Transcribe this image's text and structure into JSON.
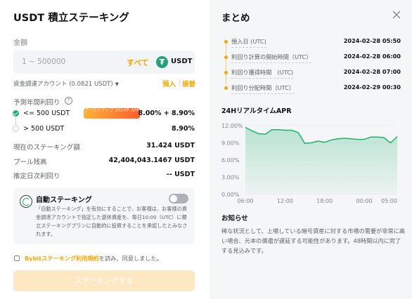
{
  "left": {
    "title": "USDT 積立ステーキング",
    "amount_label": "金額",
    "amount_placeholder": "1 ~ 500000",
    "all_button": "すべて",
    "coin_symbol": "₮",
    "coin": "USDT",
    "funding_account": "資金調達アカウント (0.0821 USDT)",
    "deposit": "預入",
    "transfer": "振替",
    "apr_label": "予測年間利回り",
    "tiers": [
      {
        "label": "<= 500 USDT",
        "value": "8.00% + 8.90%",
        "promo": "ブーストアップ 2024年\nAPR"
      },
      {
        "label": "> 500 USDT",
        "value": "8.90%"
      }
    ],
    "info": [
      {
        "key": "現在のステーキング額",
        "value": "31.424 USDT"
      },
      {
        "key": "プール残高",
        "value": "42,404,043.1467 USDT"
      },
      {
        "key": "推定日次利回り",
        "value": "-- USDT"
      }
    ],
    "auto": {
      "title": "自動ステーキング",
      "desc": "「自動ステーキング」を有効にすることで、お客様は、お客様の資金調達アカウントで指定した遊休資産を、毎日10:00（UTC）に積立ステーキングプランに自動的に投資することを承認したとみなされます。",
      "enabled": false
    },
    "agree_link": "Bybitステーキング利用規約",
    "agree_suffix": "を読み、同意しました。",
    "stake_button": "ステーキングする"
  },
  "right": {
    "title": "まとめ",
    "timeline": [
      {
        "label": "預入日 (UTC)",
        "value": "2024-02-28 05:50"
      },
      {
        "label": "利回り計算の開始時間（UTC）",
        "value": "2024-02-28 06:00"
      },
      {
        "label": "利回り獲得時間　(UTC)",
        "value": "2024-02-28 07:00"
      },
      {
        "label": "利回り分配時間（UTC）",
        "value": "2024-02-29 00:30"
      }
    ],
    "chart_title": "24HリアルタイムAPR",
    "notice_title": "お知らせ",
    "notice_text": "稀な状況として、上場している暗号資産に対する市場の需要が非常に高い場合、元本の償還が遅延する可能性があります。48時間以内に完了する見込みです。"
  },
  "colors": {
    "accent": "#f7a600",
    "green": "#20b26c",
    "coin": "#26a17b"
  },
  "chart_data": {
    "type": "area",
    "x": [
      "06:00",
      "07:00",
      "08:00",
      "09:00",
      "10:00",
      "11:00",
      "12:00",
      "13:00",
      "14:00",
      "15:00",
      "16:00",
      "17:00",
      "18:00",
      "19:00",
      "20:00",
      "21:00",
      "22:00",
      "23:00",
      "00:00",
      "01:00",
      "02:00",
      "03:00",
      "04:00",
      "05:00"
    ],
    "y": [
      11.7,
      11.1,
      10.6,
      10.5,
      11.3,
      11.3,
      11.2,
      11.2,
      10.8,
      8.9,
      9.0,
      9.3,
      9.1,
      9.5,
      9.7,
      9.8,
      9.7,
      9.6,
      9.6,
      10.0,
      10.0,
      9.9,
      9.0,
      10.1
    ],
    "x_ticks": [
      "06:00",
      "12:00",
      "18:00",
      "00:00",
      "05:00"
    ],
    "y_ticks": [
      "12.00%",
      "9.00%",
      "6.00%",
      "3.00%",
      "0.00%"
    ],
    "ylim": [
      0,
      12
    ],
    "grid": true,
    "color": "#20b26c"
  }
}
